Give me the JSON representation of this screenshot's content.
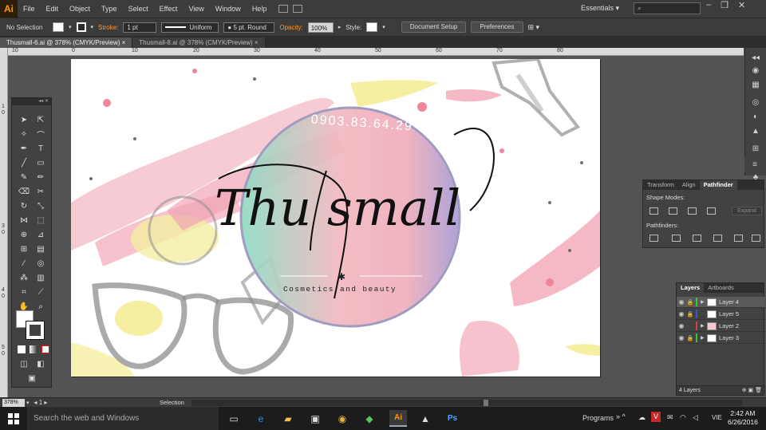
{
  "app": {
    "logo": "Ai"
  },
  "menu": [
    "File",
    "Edit",
    "Object",
    "Type",
    "Select",
    "Effect",
    "View",
    "Window",
    "Help"
  ],
  "workspace": {
    "essentials": "Essentials",
    "search_placeholder": ""
  },
  "control": {
    "selection": "No Selection",
    "stroke_label": "Stroke:",
    "stroke_value": "1 pt",
    "uniform": "Uniform",
    "brush": "5 pt. Round",
    "opacity_label": "Opacity:",
    "opacity_value": "100%",
    "style_label": "Style:",
    "doc_setup": "Document Setup",
    "preferences": "Preferences"
  },
  "tabs": [
    {
      "label": "Thusmall-6.ai @ 378% (CMYK/Preview)",
      "close": "×"
    },
    {
      "label": "Thusmall-8.ai @ 378% (CMYK/Preview)",
      "close": "×"
    }
  ],
  "ruler": {
    "h": [
      "10",
      "0",
      "10",
      "20",
      "30",
      "40",
      "50",
      "60",
      "70",
      "80"
    ],
    "v": [
      "1",
      "0",
      "3",
      "0",
      "4",
      "0",
      "5",
      "0"
    ]
  },
  "artwork": {
    "phone": "0903.83.64.29",
    "title": "Thu small",
    "tagline": "Cosmetics and beauty",
    "ornament": "✱"
  },
  "pathfinder": {
    "tabs": [
      "Transform",
      "Align",
      "Pathfinder"
    ],
    "shape_modes": "Shape Modes:",
    "pathfinders": "Pathfinders:",
    "expand": "Expand"
  },
  "layers": {
    "tabs": [
      "Layers",
      "Artboards"
    ],
    "rows": [
      {
        "name": "Layer 4",
        "color": "#37c837",
        "selected": true
      },
      {
        "name": "Layer 5",
        "color": "#4a4ae0",
        "selected": false
      },
      {
        "name": "Layer 2",
        "color": "#e03a3a",
        "selected": false
      },
      {
        "name": "Layer 3",
        "color": "#37c837",
        "selected": false
      }
    ],
    "count": "4 Layers"
  },
  "status": {
    "zoom": "378%",
    "tool": "Selection"
  },
  "taskbar": {
    "search": "Search the web and Windows",
    "programs": "Programs",
    "lang": "VIE",
    "time": "2:42 AM",
    "date": "6/26/2016"
  },
  "colors": {
    "accent": "#ff9a00",
    "pink": "#f2a6b4",
    "mint": "#8fdcc4",
    "lavender": "#a89bd6",
    "yellow": "#f6ef9c"
  }
}
